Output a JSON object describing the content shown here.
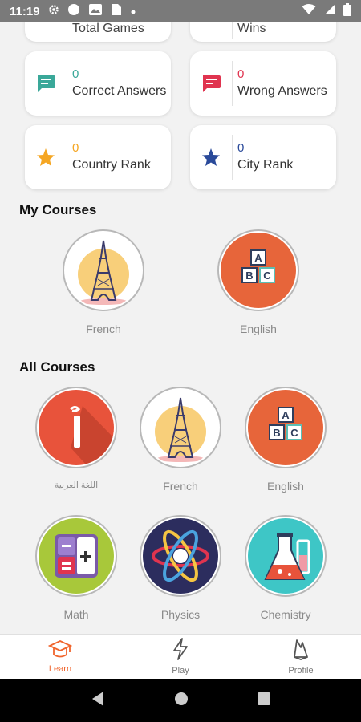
{
  "status_bar": {
    "time": "11:19",
    "icons": [
      "gear-icon",
      "circle-icon",
      "image-icon",
      "sim-icon",
      "dot-icon",
      "wifi-icon",
      "signal-icon",
      "battery-icon"
    ]
  },
  "top_partial": {
    "left_label": "Total Games",
    "right_label": "Wins"
  },
  "stats": [
    {
      "value": "0",
      "label": "Correct Answers",
      "icon": "chat-bubble-icon",
      "color": "#3aa899"
    },
    {
      "value": "0",
      "label": "Wrong Answers",
      "icon": "chat-bubble-icon",
      "color": "#e0344f"
    },
    {
      "value": "0",
      "label": "Country Rank",
      "icon": "star-icon",
      "color": "#f5a623"
    },
    {
      "value": "0",
      "label": "City Rank",
      "icon": "star-icon",
      "color": "#2a4a9a"
    }
  ],
  "my_courses": {
    "title": "My Courses",
    "items": [
      {
        "label": "French",
        "icon": "eiffel-tower-icon"
      },
      {
        "label": "English",
        "icon": "abc-blocks-icon"
      }
    ]
  },
  "all_courses": {
    "title": "All Courses",
    "items": [
      {
        "label": "اللغة العربية",
        "icon": "arabic-letter-icon"
      },
      {
        "label": "French",
        "icon": "eiffel-tower-icon"
      },
      {
        "label": "English",
        "icon": "abc-blocks-icon"
      },
      {
        "label": "Math",
        "icon": "calculator-icon"
      },
      {
        "label": "Physics",
        "icon": "atom-icon"
      },
      {
        "label": "Chemistry",
        "icon": "flask-icon"
      }
    ]
  },
  "bottom_nav": {
    "items": [
      {
        "label": "Learn",
        "icon": "graduation-cap-icon",
        "active": true
      },
      {
        "label": "Play",
        "icon": "lightning-icon",
        "active": false
      },
      {
        "label": "Profile",
        "icon": "profile-icon",
        "active": false
      }
    ]
  },
  "colors": {
    "accent": "#f0642c",
    "status_bar": "#7a7a7a",
    "background": "#f2f2f2"
  }
}
